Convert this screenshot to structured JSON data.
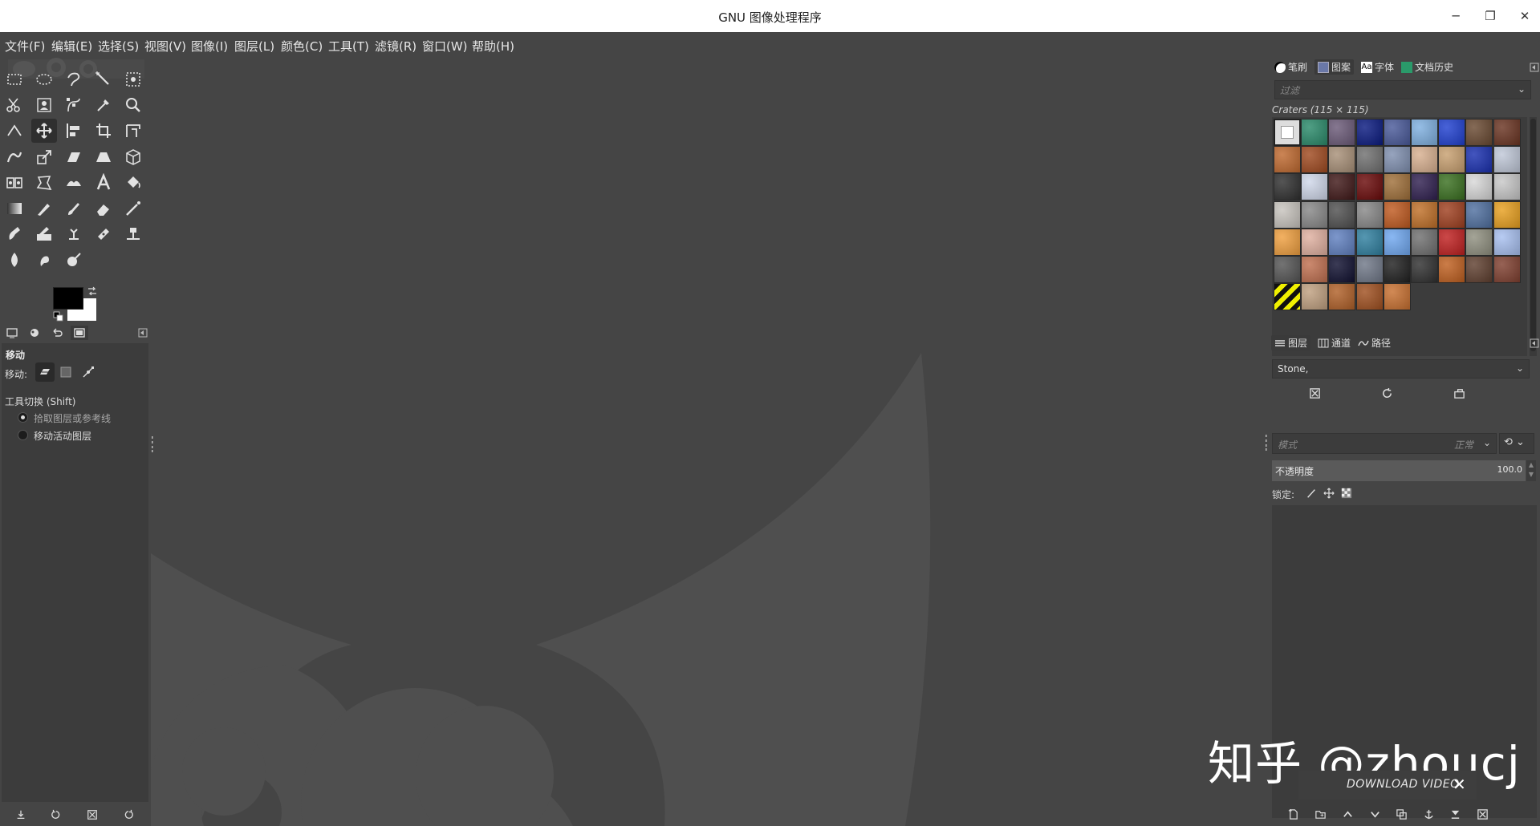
{
  "window": {
    "title": "GNU 图像处理程序",
    "minimize": "─",
    "maximize": "❐",
    "close": "✕"
  },
  "menu": [
    "文件(F)",
    "编辑(E)",
    "选择(S)",
    "视图(V)",
    "图像(I)",
    "图层(L)",
    "颜色(C)",
    "工具(T)",
    "滤镜(R)",
    "窗口(W)",
    "帮助(H)"
  ],
  "toolbox": {
    "active_tool": "move",
    "foreground_color": "#000000",
    "background_color": "#ffffff",
    "tools": [
      "rect-select",
      "ellipse-select",
      "free-select",
      "fuzzy-select",
      "select-by-color",
      "scissors",
      "foreground-select",
      "paths",
      "color-picker",
      "zoom",
      "measure",
      "move",
      "align",
      "crop",
      "unified-transform",
      "warp-transform",
      "scale",
      "shear",
      "perspective",
      "3d-transform",
      "handle-transform",
      "cage-transform",
      "flip",
      "text",
      "bucket-fill",
      "gradient",
      "pencil",
      "paintbrush",
      "eraser",
      "airbrush",
      "ink",
      "mypaint-brush",
      "clone",
      "heal",
      "perspective-clone",
      "blur",
      "smudge",
      "dodge-burn"
    ]
  },
  "tool_options": {
    "title": "移动",
    "move_label": "移动:",
    "switch_label": "工具切换  (Shift)",
    "radio_pick": "拾取图层或参考线",
    "radio_active": "移动活动图层",
    "selected_radio": "pick"
  },
  "dock_top": {
    "tabs": [
      "笔刷",
      "图案",
      "字体",
      "文档历史"
    ],
    "selected_tab": "图案",
    "filter_placeholder": "过滤",
    "pattern_caption": "Craters (115 × 115)",
    "pattern_select": "Stone,",
    "patterns": [
      "#ffffff",
      "#2a8a6a",
      "#6b5a78",
      "#0a1a80",
      "#4a5a9a",
      "#7fb0e0",
      "#2040d0",
      "#6a4a32",
      "#6a3422",
      "#c06a30",
      "#a04a20",
      "#a89078",
      "#707070",
      "#8090b0",
      "#d8b090",
      "#c8a070",
      "#1a30b0",
      "#c0c8d8",
      "#303030",
      "#d0d8ea",
      "#401818",
      "#6a0a0a",
      "#a0703a",
      "#302050",
      "#3a7020",
      "#d8d8d8",
      "#c8c8c8",
      "#c8c4be",
      "#888888",
      "#505050",
      "#888888",
      "#c05a20",
      "#c07028",
      "#a04020",
      "#5070a0",
      "#e8a020",
      "#f0a040",
      "#e0b0a0",
      "#6080c0",
      "#3080a0",
      "#70a8f0",
      "#707070",
      "#c02020",
      "#909080",
      "#a8c0f0",
      "#555555",
      "#c07050",
      "#101030",
      "#707888",
      "#202020",
      "#303030",
      "#c06020",
      "#604030",
      "#804030",
      "#e0e020",
      "#c0a080",
      "#b06028",
      "#a05020",
      "#c87030"
    ]
  },
  "dock_bottom": {
    "tabs": [
      "图层",
      "通道",
      "路径"
    ],
    "selected_tab": "图层",
    "mode_placeholder": "模式",
    "mode_value": "正常",
    "opacity_label": "不透明度",
    "opacity_value": "100.0",
    "lock_label": "锁定:"
  },
  "watermark": {
    "text": "知乎 @zhoucj",
    "download": "DOWNLOAD VIDEO",
    "close": "✕"
  }
}
